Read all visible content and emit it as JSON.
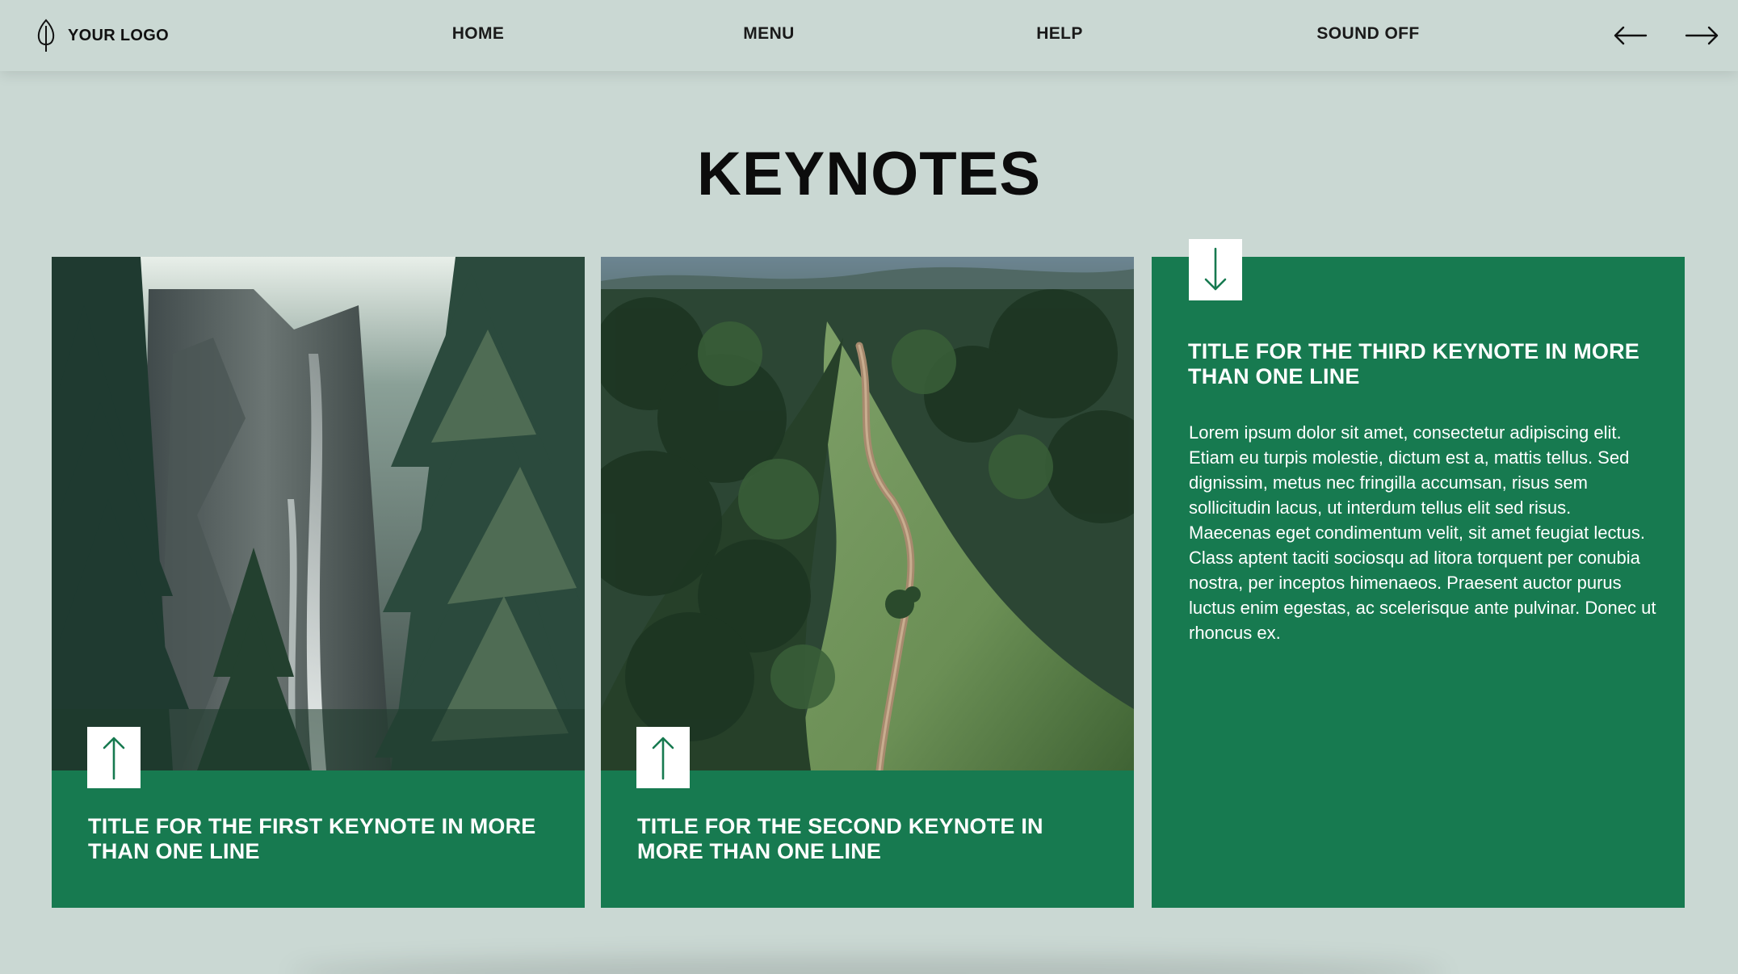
{
  "brand": {
    "logo_text": "YOUR LOGO",
    "icon": "leaf-icon"
  },
  "nav": {
    "home": "HOME",
    "menu": "MENU",
    "help": "HELP",
    "sound": "SOUND OFF",
    "prev_icon": "arrow-left-icon",
    "next_icon": "arrow-right-icon"
  },
  "page": {
    "title": "KEYNOTES"
  },
  "cards": [
    {
      "title": "TITLE FOR THE FIRST KEYNOTE IN MORE THAN ONE LINE",
      "image": "forest-waterfall-photo",
      "toggle_icon": "arrow-up-icon"
    },
    {
      "title": "TITLE FOR THE SECOND KEYNOTE IN MORE THAN ONE LINE",
      "image": "ridge-trail-photo",
      "toggle_icon": "arrow-up-icon"
    },
    {
      "title": "TITLE FOR THE THIRD KEYNOTE IN MORE THAN ONE LINE",
      "toggle_icon": "arrow-down-icon",
      "body": "Lorem ipsum dolor sit amet, consectetur adipiscing elit. Etiam eu turpis molestie, dictum est a, mattis tellus. Sed dignissim, metus nec fringilla accumsan, risus sem sollicitudin lacus, ut interdum tellus elit sed risus. Maecenas eget condimentum velit, sit amet feugiat lectus. Class aptent taciti sociosqu ad litora torquent per conubia nostra, per inceptos himenaeos. Praesent auctor purus luctus enim egestas, ac scelerisque ante pulvinar. Donec ut rhoncus ex."
    }
  ],
  "colors": {
    "background": "#cad8d3",
    "card_green": "#177a50",
    "text_dark": "#111111",
    "text_light": "#ffffff"
  }
}
